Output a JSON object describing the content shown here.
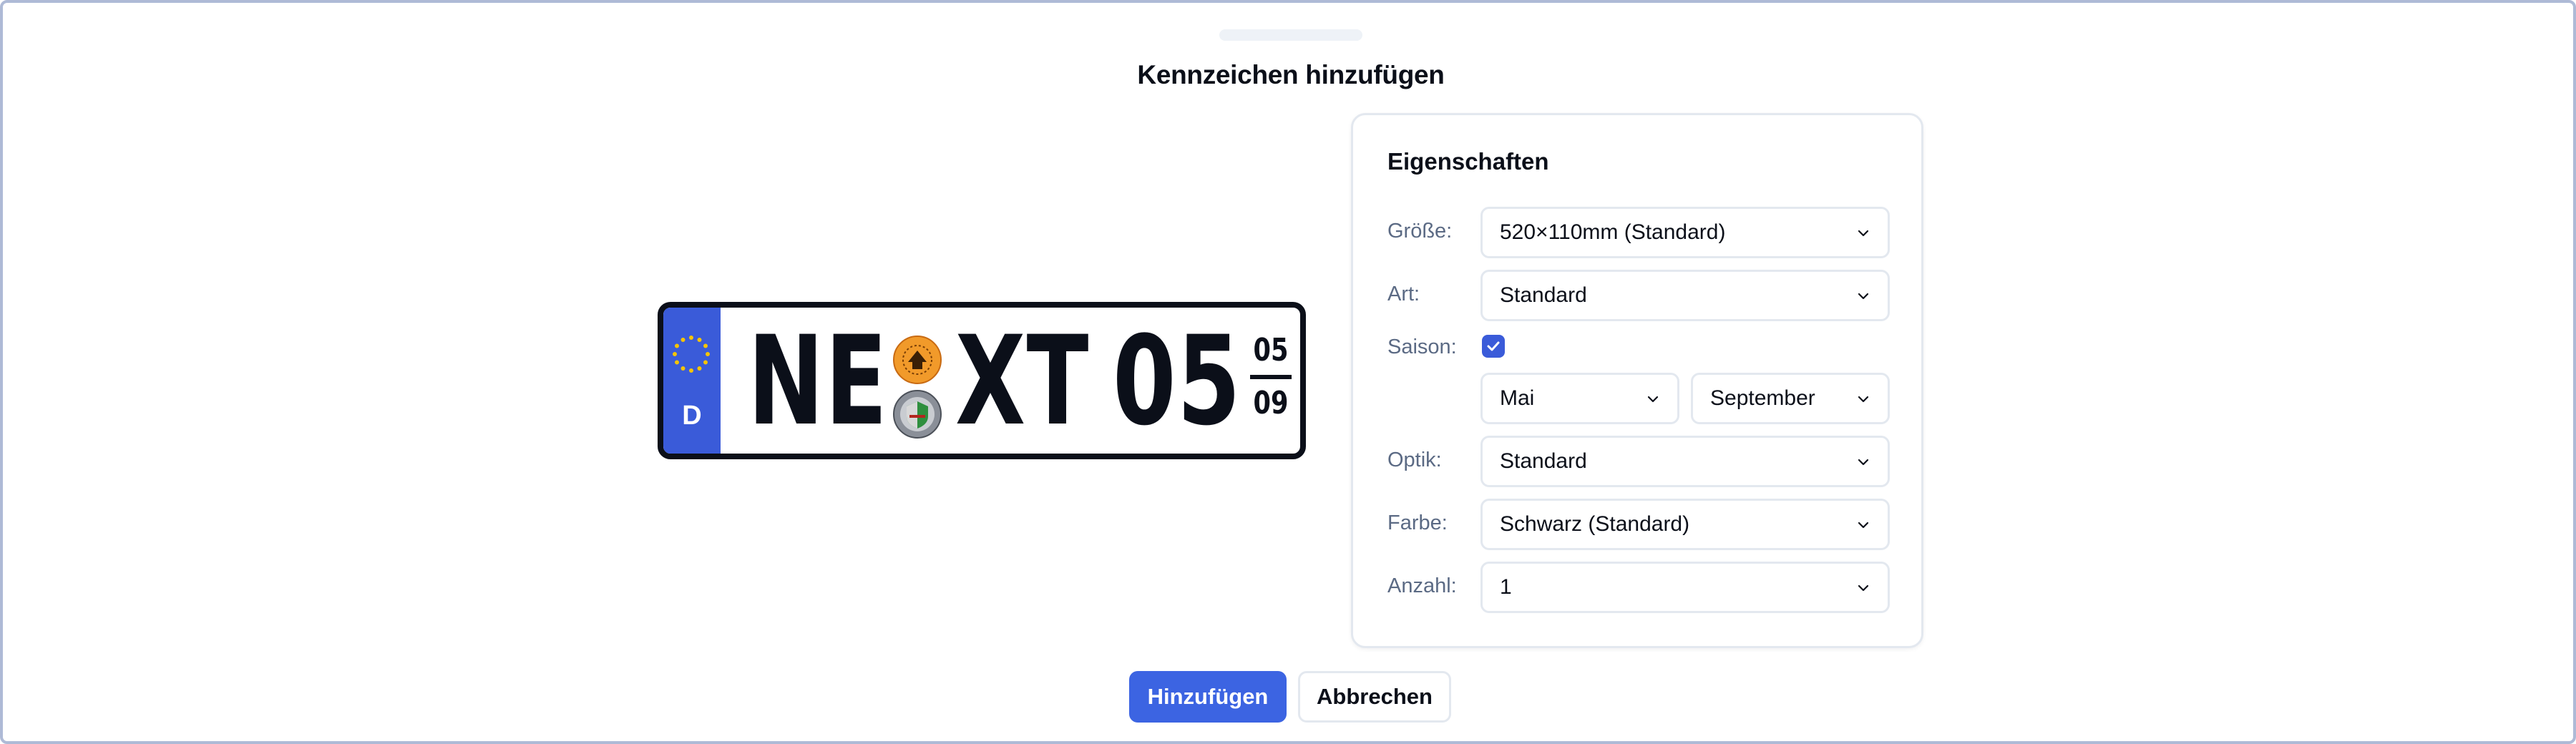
{
  "dialog": {
    "title": "Kennzeichen hinzufügen"
  },
  "plate": {
    "country_code": "D",
    "city": "NE",
    "letters": "XT",
    "digits": "05",
    "season_start": "05",
    "season_end": "09",
    "colors": {
      "eu_band": "#3a5bd9",
      "stars": "#f5c400",
      "text": "#0b0f19",
      "hu_seal": "#f19a2a"
    }
  },
  "panel": {
    "title": "Eigenschaften",
    "size": {
      "label": "Größe:",
      "value": "520×110mm (Standard)"
    },
    "type": {
      "label": "Art:",
      "value": "Standard"
    },
    "season": {
      "label": "Saison:",
      "checked": true,
      "from": "Mai",
      "to": "September"
    },
    "optics": {
      "label": "Optik:",
      "value": "Standard"
    },
    "color": {
      "label": "Farbe:",
      "value": "Schwarz (Standard)"
    },
    "quantity": {
      "label": "Anzahl:",
      "value": "1"
    }
  },
  "actions": {
    "add_label": "Hinzufügen",
    "cancel_label": "Abbrechen"
  },
  "theme": {
    "accent": "#3c64e2",
    "border": "#e3e8ef",
    "label_text": "#5b6a84"
  }
}
